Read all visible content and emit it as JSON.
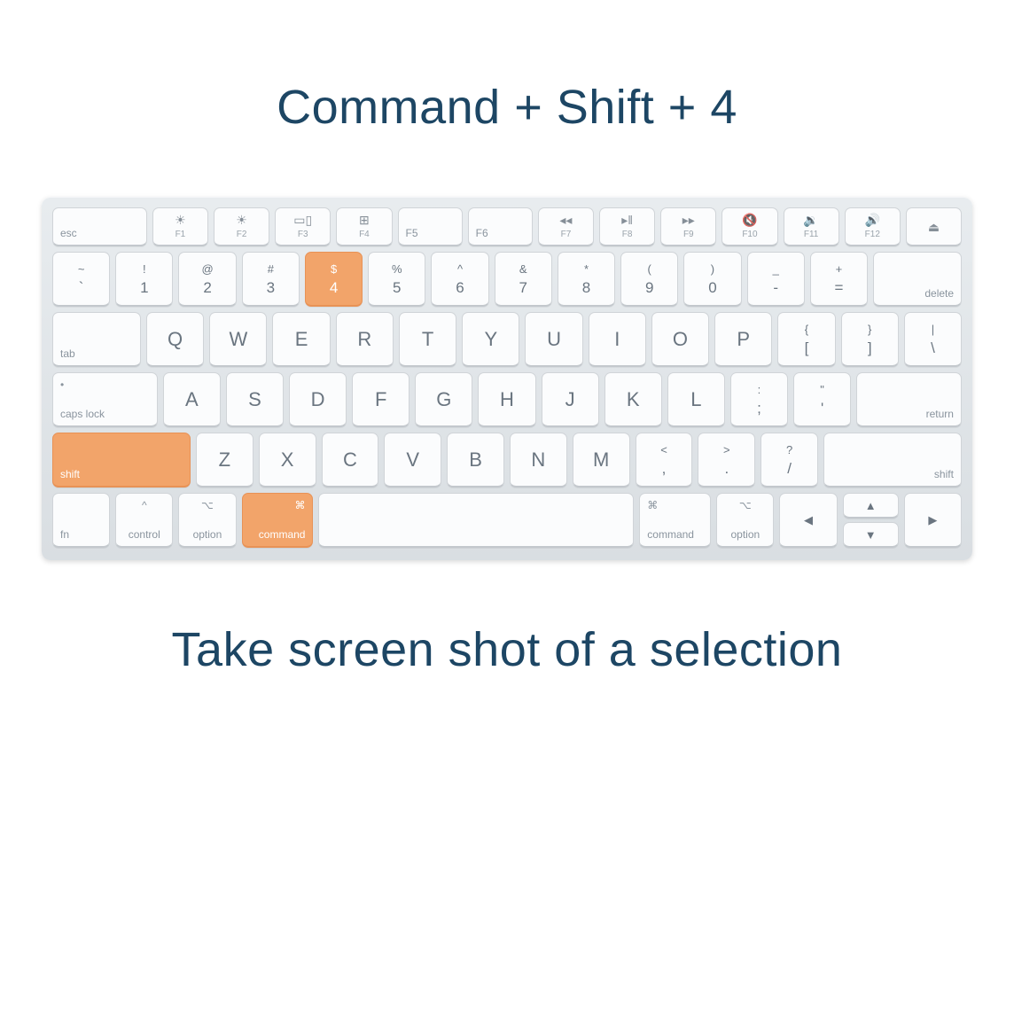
{
  "title": "Command + Shift + 4",
  "caption": "Take screen shot of a selection",
  "highlight_color": "#f2a46a",
  "text_color": "#1d4664",
  "rows": {
    "fn": [
      {
        "label": "esc",
        "icon": ""
      },
      {
        "label": "F1",
        "icon": "☀"
      },
      {
        "label": "F2",
        "icon": "☀"
      },
      {
        "label": "F3",
        "icon": "▭▯"
      },
      {
        "label": "F4",
        "icon": "⊞"
      },
      {
        "label": "F5",
        "icon": ""
      },
      {
        "label": "F6",
        "icon": ""
      },
      {
        "label": "F7",
        "icon": "◂◂"
      },
      {
        "label": "F8",
        "icon": "▸‖"
      },
      {
        "label": "F9",
        "icon": "▸▸"
      },
      {
        "label": "F10",
        "icon": "🔇"
      },
      {
        "label": "F11",
        "icon": "🔉"
      },
      {
        "label": "F12",
        "icon": "🔊"
      },
      {
        "label": "",
        "icon": "⏏"
      }
    ],
    "num": [
      {
        "top": "~",
        "bot": "`"
      },
      {
        "top": "!",
        "bot": "1"
      },
      {
        "top": "@",
        "bot": "2"
      },
      {
        "top": "#",
        "bot": "3"
      },
      {
        "top": "$",
        "bot": "4",
        "hl": true
      },
      {
        "top": "%",
        "bot": "5"
      },
      {
        "top": "^",
        "bot": "6"
      },
      {
        "top": "&",
        "bot": "7"
      },
      {
        "top": "*",
        "bot": "8"
      },
      {
        "top": "(",
        "bot": "9"
      },
      {
        "top": ")",
        "bot": "0"
      },
      {
        "top": "_",
        "bot": "-"
      },
      {
        "top": "+",
        "bot": "="
      },
      {
        "corner_br": "delete",
        "wide": 1.55
      }
    ],
    "qw": [
      {
        "corner_bl": "tab",
        "wide": 1.55
      },
      {
        "lbl": "Q"
      },
      {
        "lbl": "W"
      },
      {
        "lbl": "E"
      },
      {
        "lbl": "R"
      },
      {
        "lbl": "T"
      },
      {
        "lbl": "Y"
      },
      {
        "lbl": "U"
      },
      {
        "lbl": "I"
      },
      {
        "lbl": "O"
      },
      {
        "lbl": "P"
      },
      {
        "top": "{",
        "bot": "["
      },
      {
        "top": "}",
        "bot": "]"
      },
      {
        "top": "|",
        "bot": "\\"
      }
    ],
    "as": [
      {
        "corner_tl": "•",
        "corner_bl": "caps lock",
        "wide": 1.85
      },
      {
        "lbl": "A"
      },
      {
        "lbl": "S"
      },
      {
        "lbl": "D"
      },
      {
        "lbl": "F"
      },
      {
        "lbl": "G"
      },
      {
        "lbl": "H"
      },
      {
        "lbl": "J"
      },
      {
        "lbl": "K"
      },
      {
        "lbl": "L"
      },
      {
        "top": ":",
        "bot": ";"
      },
      {
        "top": "\"",
        "bot": "'"
      },
      {
        "corner_br": "return",
        "wide": 1.85
      }
    ],
    "zx": [
      {
        "corner_bl": "shift",
        "wide": 2.45,
        "hl": true
      },
      {
        "lbl": "Z"
      },
      {
        "lbl": "X"
      },
      {
        "lbl": "C"
      },
      {
        "lbl": "V"
      },
      {
        "lbl": "B"
      },
      {
        "lbl": "N"
      },
      {
        "lbl": "M"
      },
      {
        "top": "<",
        "bot": ","
      },
      {
        "top": ">",
        "bot": "."
      },
      {
        "top": "?",
        "bot": "/"
      },
      {
        "corner_br": "shift",
        "wide": 2.45
      }
    ],
    "mod": [
      {
        "corner_bl": "fn"
      },
      {
        "corner_tc": "^",
        "corner_bc": "control"
      },
      {
        "corner_tc": "⌥",
        "corner_bc": "option"
      },
      {
        "corner_tr": "⌘",
        "corner_br": "command",
        "wide": 1.25,
        "hl": true
      },
      {
        "space": true,
        "wide": 5.6
      },
      {
        "corner_tl": "⌘",
        "corner_bl": "command",
        "wide": 1.25
      },
      {
        "corner_tc": "⌥",
        "corner_bc": "option"
      },
      {
        "lbl": "◀",
        "arrow": true
      },
      {
        "arrows_split": true
      },
      {
        "lbl": "▶",
        "arrow": true
      }
    ]
  }
}
